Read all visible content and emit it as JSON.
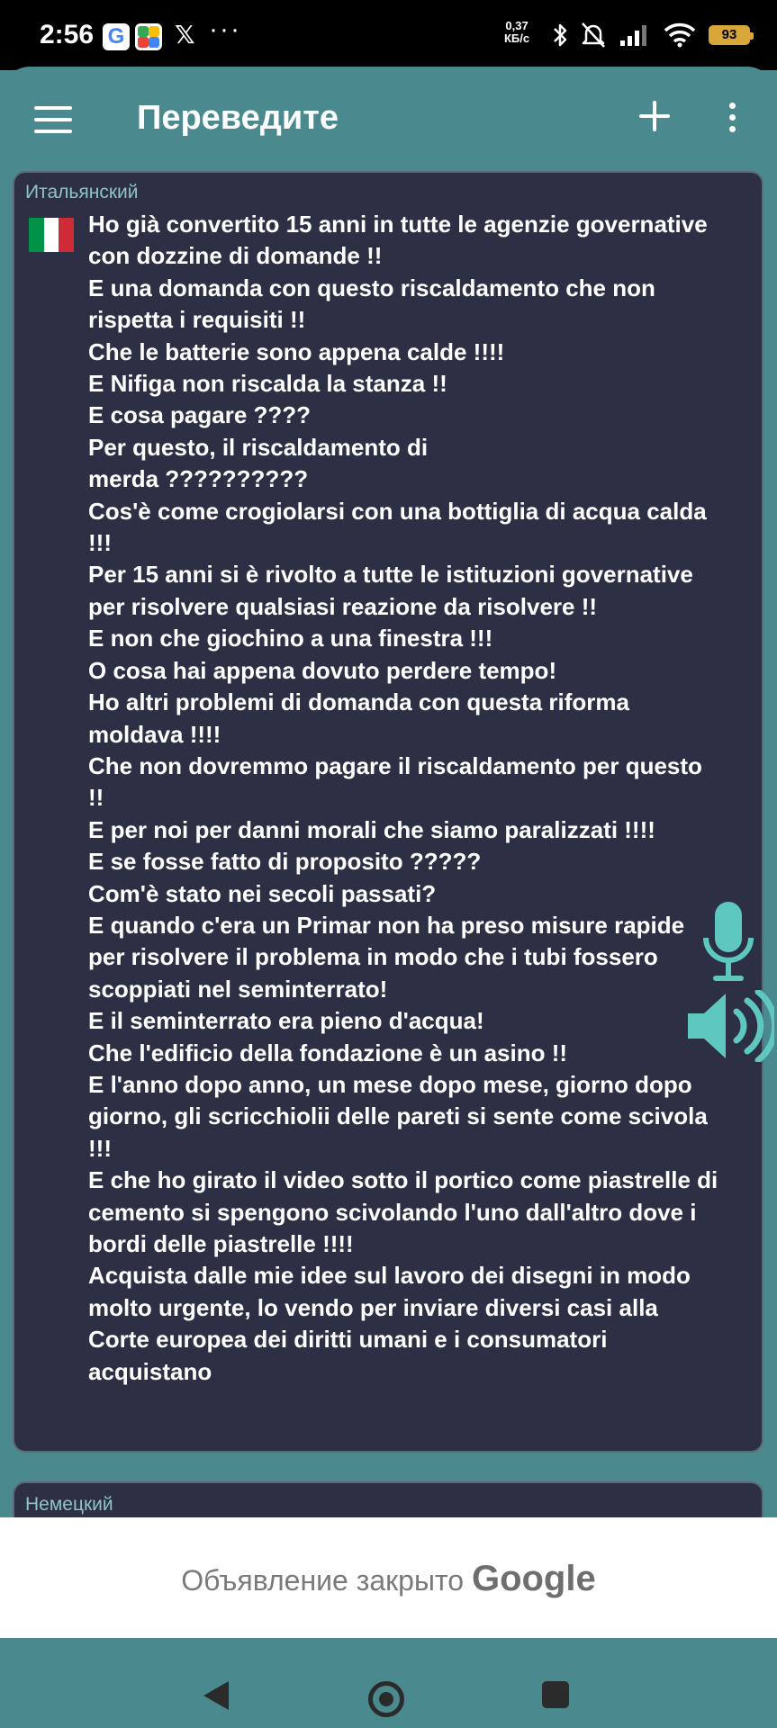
{
  "status_bar": {
    "time": "2:56",
    "notif_icons": [
      "google-icon",
      "app-icon",
      "x-icon"
    ],
    "overflow": "···",
    "speed_value": "0,37",
    "speed_unit": "КБ/с",
    "battery": "93",
    "battery_color": "#d9a63a"
  },
  "app_bar": {
    "title": "Переведите",
    "icons": [
      "menu-icon",
      "add-icon",
      "more-vert-icon"
    ]
  },
  "source_card": {
    "language": "Итальянский",
    "flag_colors": [
      "#009246",
      "#ffffff",
      "#ce2b37"
    ],
    "text": "Ho già convertito 15 anni in tutte le agenzie governative con dozzine di domande !!\nE una domanda con questo riscaldamento che non rispetta i requisiti !!\nChe le batterie sono appena calde !!!!\nE Nifiga non riscalda la stanza !!\nE cosa pagare ????\nPer questo, il riscaldamento di\nmerda ??????????\nCos'è come crogiolarsi con una bottiglia di acqua calda !!!\nPer 15 anni si è rivolto a tutte le istituzioni governative per risolvere qualsiasi reazione da risolvere !!\nE non che giochino a una finestra !!!\nO cosa hai appena dovuto perdere tempo!\nHo altri problemi di domanda con questa riforma moldava !!!!\nChe non dovremmo pagare il riscaldamento per questo !!\nE per noi per danni morali che siamo paralizzati !!!!\nE se fosse fatto di proposito ?????\nCom'è stato nei secoli passati?\nE quando c'era un Primar non ha preso misure rapide per risolvere il problema in modo che i tubi fossero scoppiati nel seminterrato!\nE il seminterrato era pieno d'acqua!\nChe l'edificio della fondazione è un asino !!\nE l'anno dopo anno, un mese dopo mese, giorno dopo giorno, gli scricchiolii delle pareti si sente come scivola !!!\nE che ho girato il video sotto il portico come piastrelle di cemento si spengono scivolando l'uno dall'altro dove i bordi delle piastrelle !!!!\nAcquista dalle mie idee sul lavoro dei disegni in modo molto urgente, lo vendo per inviare diversi casi alla Corte europea dei diritti umani e i consumatori acquistano",
    "accent_color": "#5ec8c0"
  },
  "target_card": {
    "language": "Немецкий"
  },
  "ad_banner": {
    "text": "Объявление закрыто",
    "brand": "Google"
  },
  "colors": {
    "theme": "#4a8a8e",
    "card_bg": "#2d3045",
    "label": "#8ec4c7"
  }
}
